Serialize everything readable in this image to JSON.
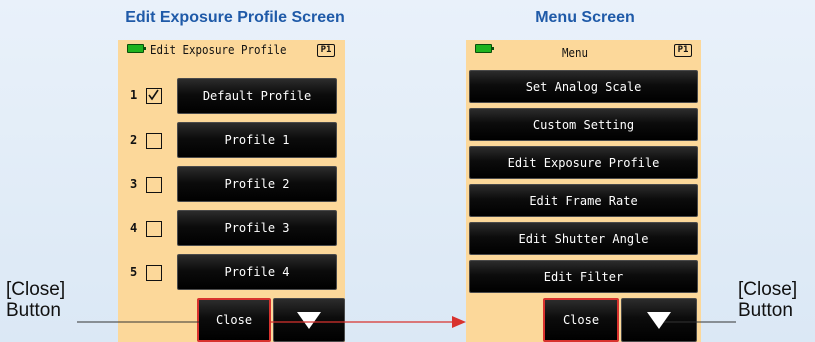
{
  "left_panel": {
    "title": "Edit Exposure Profile Screen",
    "heading": "Edit Exposure Profile",
    "page_badge": "P1",
    "rows": [
      {
        "number": "1",
        "checked": true,
        "label": "Default Profile"
      },
      {
        "number": "2",
        "checked": false,
        "label": "Profile 1"
      },
      {
        "number": "3",
        "checked": false,
        "label": "Profile 2"
      },
      {
        "number": "4",
        "checked": false,
        "label": "Profile 3"
      },
      {
        "number": "5",
        "checked": false,
        "label": "Profile 4"
      }
    ],
    "close_label": "Close",
    "down_icon": "triangle-down-icon"
  },
  "right_panel": {
    "title": "Menu Screen",
    "heading": "Menu",
    "page_badge": "P1",
    "items": [
      "Set Analog Scale",
      "Custom Setting",
      "Edit Exposure Profile",
      "Edit Frame Rate",
      "Edit Shutter Angle",
      "Edit Filter"
    ],
    "close_label": "Close",
    "down_icon": "triangle-down-icon"
  },
  "callouts": {
    "left_line1": "[Close]",
    "left_line2": "Button",
    "right_line1": "[Close]",
    "right_line2": "Button"
  },
  "colors": {
    "title_blue": "#1f5aa8",
    "screen_bg": "#fcd89a",
    "highlight_red": "#d8322e",
    "battery_green": "#1fb31f"
  }
}
